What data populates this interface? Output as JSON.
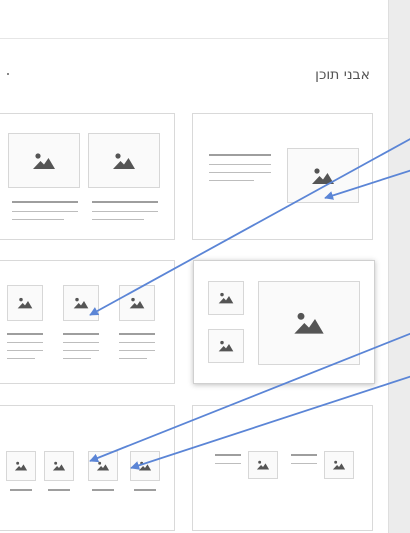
{
  "panel": {
    "title": "אבני תוכן"
  },
  "colors": {
    "arrow": "#5b85d6",
    "icon": "#555555",
    "scrollbar": "#ececec"
  },
  "blocks": [
    "text-image",
    "two-images-with-text",
    "three-images-with-text",
    "two-small-one-large-image",
    "four-images-with-text",
    "text-image-pairs"
  ]
}
